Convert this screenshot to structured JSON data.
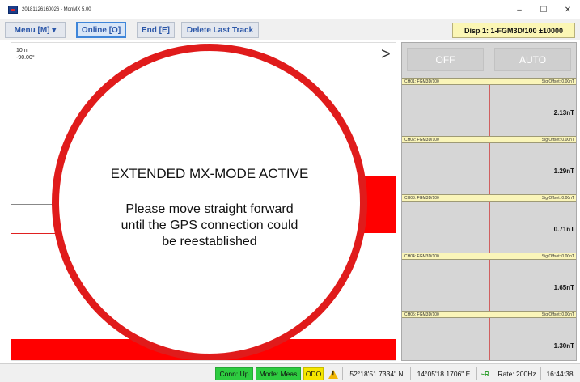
{
  "window": {
    "title": "20181126160026 - MonMX 5.00",
    "min_glyph": "–",
    "max_glyph": "☐",
    "close_glyph": "✕"
  },
  "toolbar": {
    "menu_label": "Menu [M] ▾",
    "online_label": "Online [O]",
    "end_label": "End [E]",
    "delete_label": "Delete Last Track",
    "disp_label": "Disp 1: 1-FGM3D/100  ±10000"
  },
  "plot": {
    "scale": "10m",
    "angle": "-90.00°",
    "next_glyph": ">",
    "message_title": "EXTENDED MX-MODE ACTIVE",
    "message_lines": [
      "Please move straight forward",
      "until the GPS connection could",
      "be reestablished"
    ],
    "zoom_in": "+",
    "zoom_out": "-"
  },
  "panel": {
    "off_label": "OFF",
    "auto_label": "AUTO",
    "channels": [
      {
        "name": "CH01: FGM3D/100",
        "offset": "Sig.Offset: 0.00nT",
        "value": "2.13nT"
      },
      {
        "name": "CH02: FGM3D/100",
        "offset": "Sig.Offset: 0.00nT",
        "value": "1.29nT"
      },
      {
        "name": "CH03: FGM3D/100",
        "offset": "Sig.Offset: 0.00nT",
        "value": "0.71nT"
      },
      {
        "name": "CH04: FGM3D/100",
        "offset": "Sig.Offset: 0.00nT",
        "value": "1.65nT"
      },
      {
        "name": "CH05: FGM3D/100",
        "offset": "Sig.Offset: 0.00nT",
        "value": "1.30nT"
      }
    ]
  },
  "status": {
    "conn": "Conn: Up",
    "mode": "Mode: Meas",
    "odo": "ODO",
    "lat": "52°18'51.7334\" N",
    "lon": "14°05'18.1706\" E",
    "fix": "~R",
    "rate": "Rate: 200Hz",
    "time": "16:44:38"
  },
  "colors": {
    "alert_red": "#ff0000",
    "status_green": "#2ecc40",
    "odo_yellow": "#f5e600",
    "disp_yellow": "#fbf6b5"
  }
}
